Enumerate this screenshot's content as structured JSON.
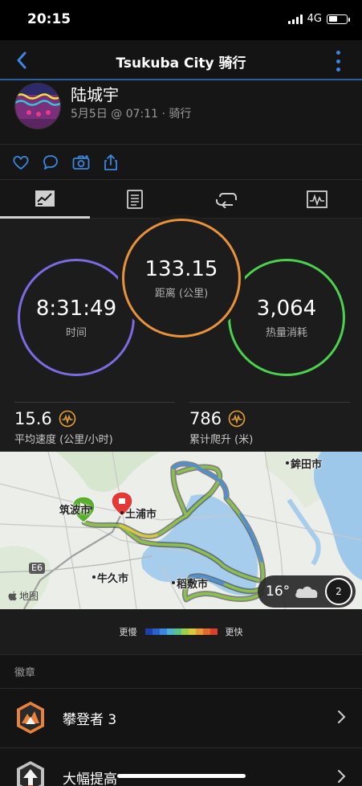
{
  "status_bar": {
    "time": "20:15",
    "network": "4G",
    "battery_level": 0.5
  },
  "nav": {
    "title": "Tsukuba City 骑行",
    "back_icon": "chevron-left-icon",
    "more_icon": "more-vertical-icon",
    "accent": "#3b86e0"
  },
  "profile": {
    "name": "陆城宇",
    "meta": "5月5日 @ 07:11 · 骑行"
  },
  "actions": [
    "heart-icon",
    "comment-icon",
    "camera-icon",
    "share-icon"
  ],
  "tabs": [
    {
      "icon": "stats-chart-icon",
      "active": true
    },
    {
      "icon": "details-list-icon",
      "active": false
    },
    {
      "icon": "laps-icon",
      "active": false
    },
    {
      "icon": "graph-icon",
      "active": false
    }
  ],
  "summary": {
    "time": {
      "value": "8:31:49",
      "label": "时间",
      "color": "#7b6be0"
    },
    "distance": {
      "value": "133.15",
      "label": "距离 (公里)",
      "color": "#e8923a"
    },
    "calories": {
      "value": "3,064",
      "label": "热量消耗",
      "color": "#4bd14e"
    }
  },
  "metrics": [
    {
      "value": "15.6",
      "label": "平均速度 (公里/小时)"
    },
    {
      "value": "786",
      "label": "累计爬升 (米)"
    }
  ],
  "map": {
    "places": {
      "hokota": "鉾田市",
      "tsukuba": "筑波市",
      "tsuchiura": "土浦市",
      "ushiku": "牛久市",
      "inashiki": "稻敷市",
      "highway": "E6"
    },
    "attribution": "地图",
    "weather": {
      "temperature": "16°",
      "icon": "cloud-icon",
      "wind": "2"
    }
  },
  "legend": {
    "slow": "更慢",
    "fast": "更快",
    "colors": [
      "#1f3fa8",
      "#2a62c9",
      "#3b86e0",
      "#4fb0d0",
      "#5cc28a",
      "#9ccf4a",
      "#d6c93c",
      "#e89a36",
      "#e06a2e",
      "#d8402a"
    ]
  },
  "badges": {
    "title": "徽章",
    "items": [
      {
        "label": "攀登者 3",
        "icon": "climber-badge-icon"
      },
      {
        "label": "大幅提高",
        "icon": "improvement-badge-icon"
      }
    ]
  }
}
